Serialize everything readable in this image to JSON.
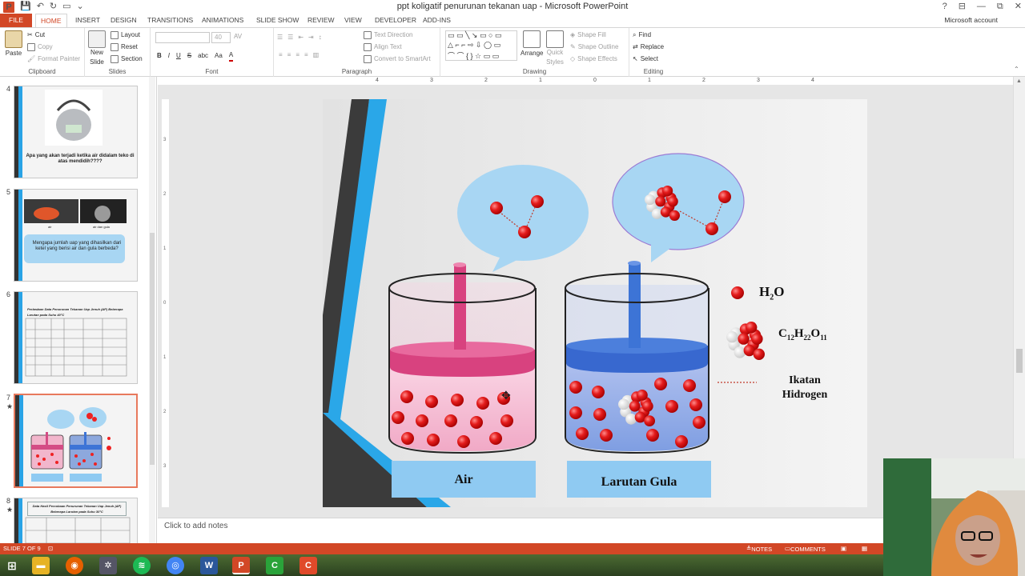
{
  "window": {
    "title": "ppt  koligatif penurunan tekanan uap - Microsoft PowerPoint",
    "controls": [
      "?",
      "⊟",
      "—",
      "⧉",
      "✕"
    ]
  },
  "tabs": {
    "file": "FILE",
    "items": [
      "HOME",
      "INSERT",
      "DESIGN",
      "TRANSITIONS",
      "ANIMATIONS",
      "SLIDE SHOW",
      "REVIEW",
      "VIEW",
      "DEVELOPER",
      "ADD-INS"
    ],
    "account": "Microsoft account"
  },
  "ribbon": {
    "clipboard": {
      "name": "Clipboard",
      "paste": "Paste",
      "cut": "Cut",
      "copy": "Copy",
      "format_painter": "Format Painter"
    },
    "slides": {
      "name": "Slides",
      "new_slide": "New",
      "new_slide_2": "Slide",
      "layout": "Layout",
      "reset": "Reset",
      "section": "Section"
    },
    "font": {
      "name": "Font",
      "size": "40",
      "bold": "B",
      "italic": "I",
      "underline": "U",
      "strike": "S",
      "spacing": "abc",
      "case": "AV",
      "aa": "Aa",
      "color": "A"
    },
    "paragraph": {
      "name": "Paragraph",
      "text_direction": "Text Direction",
      "align_text": "Align Text",
      "smartart": "Convert to SmartArt"
    },
    "drawing": {
      "name": "Drawing",
      "arrange": "Arrange",
      "quick_styles": "Quick",
      "quick_styles_2": "Styles",
      "shape_fill": "Shape Fill",
      "shape_outline": "Shape Outline",
      "shape_effects": "Shape Effects"
    },
    "editing": {
      "name": "Editing",
      "find": "Find",
      "replace": "Replace",
      "select": "Select"
    }
  },
  "ruler": {
    "labels": [
      "4",
      "3",
      "2",
      "1",
      "0",
      "1",
      "2",
      "3",
      "4"
    ]
  },
  "vruler": {
    "labels": [
      "3",
      "2",
      "1",
      "0",
      "1",
      "2",
      "3"
    ]
  },
  "thumbnails": [
    {
      "number": "4",
      "star": "",
      "caption": "Apa yang akan terjadi ketika air didalam teko di atas mendidih????"
    },
    {
      "number": "5",
      "star": "",
      "caption": "Mengapa jumlah uap yang dihasilkan dari ketel yang berisi air dan gula berbeda?",
      "img_caption_1": "air",
      "img_caption_2": "air dan gula"
    },
    {
      "number": "6",
      "star": "",
      "caption": "Perbedaan Data Penurunan Tekanan Uap Jenuh (ΔP) Beberapa Larutan pada Suhu 40°C"
    },
    {
      "number": "7",
      "star": "★",
      "caption": ""
    },
    {
      "number": "8",
      "star": "★",
      "caption": "Data Hasil Percobaan Penurunan Tekanan Uap Jenuh (ΔP) Beberapa Larutan pada Suhu 30°C"
    }
  ],
  "slide": {
    "label_left": "Air",
    "label_right": "Larutan Gula",
    "legend_h2o": "H",
    "legend_h2o_sub": "2",
    "legend_h2o_o": "O",
    "legend_sugar": "C",
    "legend_sugar_sub1": "12",
    "legend_sugar_h": "H",
    "legend_sugar_sub2": "22",
    "legend_sugar_o": "O",
    "legend_sugar_sub3": "11",
    "legend_bond_1": "Ikatan",
    "legend_bond_2": "Hidrogen",
    "colors": {
      "pink": "#e0558f",
      "blue": "#3d74d6",
      "stripe_blue": "#2aa7e8",
      "stripe_dark": "#3a3a3a",
      "bubble": "#a8d6f3",
      "label_bg": "#8fcaf2"
    }
  },
  "notes": {
    "placeholder": "Click to add notes"
  },
  "statusbar": {
    "slide": "SLIDE 7 OF 9",
    "notes": "NOTES",
    "comments": "COMMENTS"
  },
  "taskbar": {
    "items": [
      "windows-logo",
      "file-explorer",
      "firefox",
      "app",
      "spotify",
      "chrome",
      "word",
      "powerpoint",
      "camtasia",
      "camtasia-recorder"
    ]
  }
}
